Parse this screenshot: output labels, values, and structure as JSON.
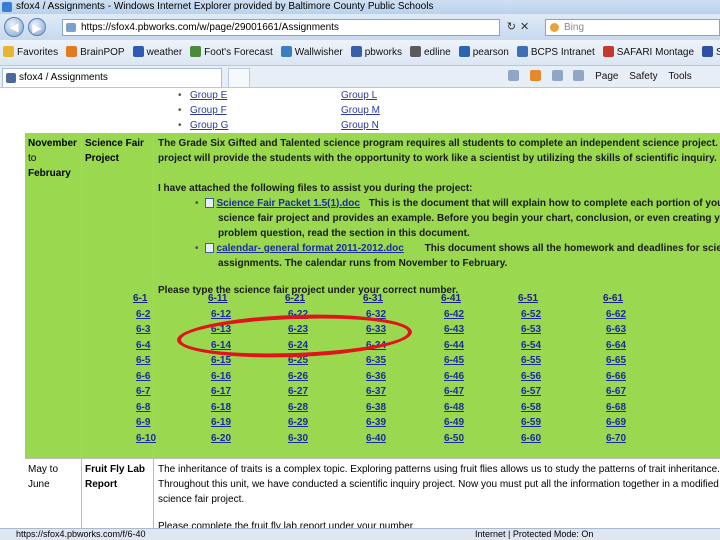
{
  "window": {
    "title": "sfox4 / Assignments - Windows Internet Explorer provided by Baltimore County Public Schools"
  },
  "address": {
    "url": "https://sfox4.pbworks.com/w/page/29001661/Assignments",
    "search_placeholder": "Bing"
  },
  "favorites": [
    {
      "label": "Favorites",
      "color": "#e5b631"
    },
    {
      "label": "BrainPOP",
      "color": "#e07b22"
    },
    {
      "label": "weather",
      "color": "#2c5bb5"
    },
    {
      "label": "Foot's Forecast",
      "color": "#4a8a3a"
    },
    {
      "label": "Wallwisher",
      "color": "#3b7fc2"
    },
    {
      "label": "pbworks",
      "color": "#3b5ea8"
    },
    {
      "label": "edline",
      "color": "#5b5b5b"
    },
    {
      "label": "pearson",
      "color": "#2a64b2"
    },
    {
      "label": "BCPS Intranet",
      "color": "#3c6fb4"
    },
    {
      "label": "SAFARI Montage",
      "color": "#c23a2b"
    },
    {
      "label": "STARS L",
      "color": "#2f4fa0"
    }
  ],
  "tab": {
    "label": "sfox4 / Assignments"
  },
  "commands": {
    "page": "Page",
    "safety": "Safety",
    "tools": "Tools"
  },
  "groups_top": {
    "left": [
      "Group E",
      "Group F",
      "Group G"
    ],
    "right": [
      "Group L",
      "Group M",
      "Group N"
    ]
  },
  "row1": {
    "date": "November to February",
    "date_lines": [
      "November",
      "to",
      "February"
    ],
    "topic_lines": [
      "Science Fair",
      "Project"
    ],
    "intro_lines": [
      "The Grade Six Gifted and Talented science program requires all students to complete an independent science project. This",
      "project will provide the students with the opportunity to work like a scientist by utilizing the skills of scientific inquiry."
    ],
    "attached": "I have attached the following files to assist you during the project:",
    "file1_link": "Science Fair Packet 1.5(1).doc",
    "file1_text": "This is the document that will explain how to complete each portion of your",
    "file1_lines": [
      "science fair project and provides an example.  Before you begin your chart, conclusion, or even creating your",
      "problem question, read the section in this document."
    ],
    "file2_link": "calendar- general format 2011-2012.doc",
    "file2_text": "This document shows all the homework and deadlines for science fair",
    "file2_line2": "assignments.  The calendar runs from November to February.",
    "type_prompt": "Please type the science fair project under your correct number."
  },
  "number_columns": [
    [
      "6-1",
      "6-2",
      "6-3",
      "6-4",
      "6-5",
      "6-6",
      "6-7",
      "6-8",
      "6-9",
      "6-10"
    ],
    [
      "6-11",
      "6-12",
      "6-13",
      "6-14",
      "6-15",
      "6-16",
      "6-17",
      "6-18",
      "6-19",
      "6-20"
    ],
    [
      "6-21",
      "6-22",
      "6-23",
      "6-24",
      "6-25",
      "6-26",
      "6-27",
      "6-28",
      "6-29",
      "6-30"
    ],
    [
      "6-31",
      "6-32",
      "6-33",
      "6-34",
      "6-35",
      "6-36",
      "6-37",
      "6-38",
      "6-39",
      "6-40"
    ],
    [
      "6-41",
      "6-42",
      "6-43",
      "6-44",
      "6-45",
      "6-46",
      "6-47",
      "6-48",
      "6-49",
      "6-50"
    ],
    [
      "6-51",
      "6-52",
      "6-53",
      "6-54",
      "6-55",
      "6-56",
      "6-57",
      "6-58",
      "6-59",
      "6-60"
    ],
    [
      "6-61",
      "6-62",
      "6-63",
      "6-64",
      "6-65",
      "6-66",
      "6-67",
      "6-68",
      "6-69",
      "6-70"
    ]
  ],
  "row2": {
    "date_lines": [
      "May to",
      "June"
    ],
    "topic_lines": [
      "Fruit Fly Lab",
      "Report"
    ],
    "text_lines": [
      "The inheritance of traits is a complex topic.  Exploring patterns using fruit flies allows us to study the patterns of trait inheritance.",
      "Throughout this unit, we have conducted a scientific inquiry project.  Now you must put all the information together in a modified",
      "science fair project."
    ],
    "cut_line": "Please complete the fruit fly lab report under your number."
  },
  "status": {
    "text": "https://sfox4.pbworks.com/f/6-40",
    "zone": "Internet | Protected Mode: On"
  },
  "colors": {
    "highlight_green": "#9ad94f",
    "annotation_red": "#e0141a",
    "link_blue": "#1c2aa0"
  }
}
